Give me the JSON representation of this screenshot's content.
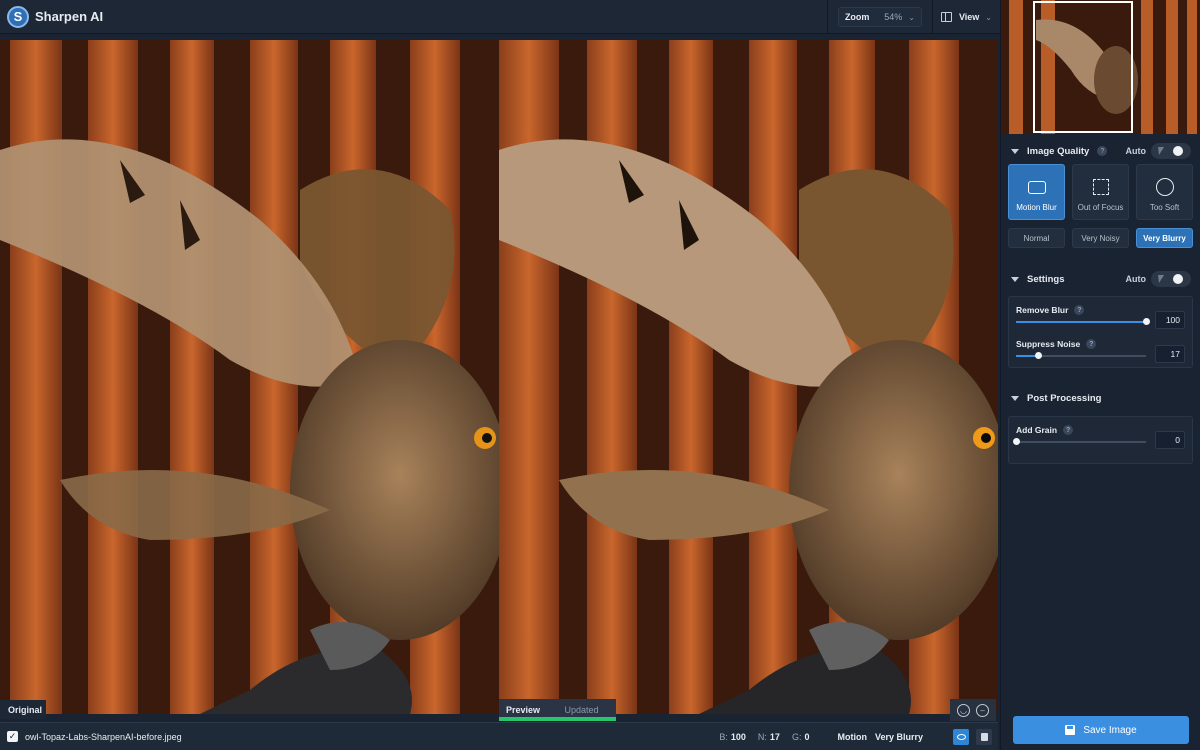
{
  "app": {
    "title": "Sharpen AI",
    "logo_letter": "S"
  },
  "header": {
    "zoom_label": "Zoom",
    "zoom_value": "54%",
    "view_label": "View"
  },
  "canvas": {
    "original_label": "Original",
    "preview_tab": "Preview",
    "updated_tab": "Updated"
  },
  "bottom_bar": {
    "filename": "owl-Topaz-Labs-SharpenAI-before.jpeg",
    "b_label": "B:",
    "b_value": "100",
    "n_label": "N:",
    "n_value": "17",
    "g_label": "G:",
    "g_value": "0",
    "mode_label": "Motion",
    "mode_value": "Very Blurry"
  },
  "sidebar": {
    "image_quality": {
      "title": "Image Quality",
      "auto_label": "Auto",
      "modes": [
        {
          "label": "Motion Blur",
          "active": true
        },
        {
          "label": "Out of Focus",
          "active": false
        },
        {
          "label": "Too Soft",
          "active": false
        }
      ],
      "levels": [
        {
          "label": "Normal",
          "active": false
        },
        {
          "label": "Very Noisy",
          "active": false
        },
        {
          "label": "Very Blurry",
          "active": true
        }
      ]
    },
    "settings": {
      "title": "Settings",
      "auto_label": "Auto",
      "remove_blur": {
        "label": "Remove Blur",
        "value": "100",
        "level": 1.0
      },
      "suppress_noise": {
        "label": "Suppress Noise",
        "value": "17",
        "level": 0.17
      }
    },
    "post_processing": {
      "title": "Post Processing",
      "add_grain": {
        "label": "Add Grain",
        "value": "0",
        "level": 0.0
      }
    },
    "save_label": "Save Image"
  },
  "colors": {
    "accent": "#3a8fe0",
    "active_card": "#2d72b6",
    "preview_bar": "#27c56c"
  }
}
